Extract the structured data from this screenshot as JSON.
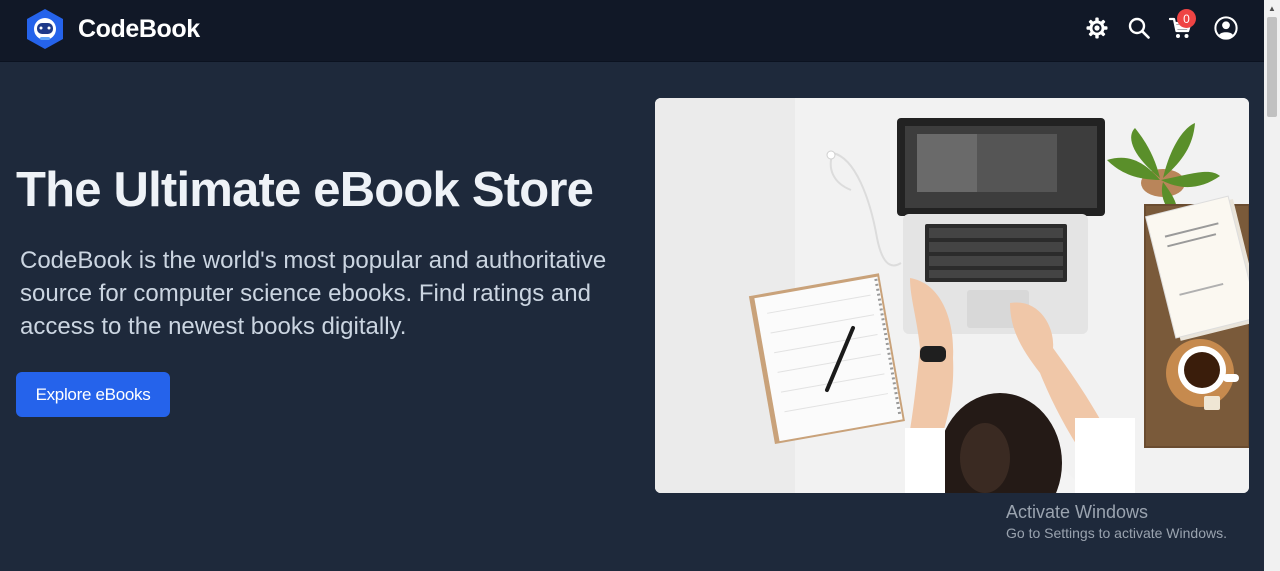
{
  "navbar": {
    "brand_name": "CodeBook",
    "logo_icon": "astronaut-logo-icon",
    "icons": [
      "gear-icon",
      "search-icon",
      "cart-icon",
      "user-circle-icon"
    ],
    "cart_count": "0"
  },
  "hero": {
    "title": "The Ultimate eBook Store",
    "description": "CodeBook is the world's most popular and authoritative source for computer science ebooks. Find ratings and access to the newest books digitally.",
    "button_label": "Explore eBooks",
    "image_subject": "hero-workspace-photo"
  },
  "watermark": {
    "title": "Activate Windows",
    "subtitle": "Go to Settings to activate Windows."
  },
  "colors": {
    "page_bg": "#1e293b",
    "navbar_bg": "#111827",
    "accent": "#2563eb",
    "badge": "#ef4444"
  }
}
